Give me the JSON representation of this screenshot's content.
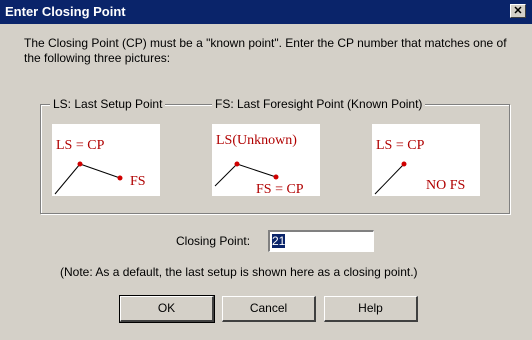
{
  "dialog": {
    "title": "Enter Closing Point",
    "close_glyph": "✕",
    "instructions": "The Closing Point (CP) must be a \"known point\". Enter the CP number that matches one of the following three pictures:"
  },
  "group": {
    "ls_legend": "LS: Last Setup Point",
    "fs_legend": "FS: Last Foresight Point (Known Point)",
    "pictures": [
      {
        "labels": [
          "LS = CP",
          "FS"
        ]
      },
      {
        "labels": [
          "LS(Unknown)",
          "FS = CP"
        ]
      },
      {
        "labels": [
          "LS = CP",
          "NO FS"
        ]
      }
    ],
    "line_color": "#000000",
    "point_color": "#d00000",
    "label_color": "#b00000"
  },
  "closing_point": {
    "label": "Closing Point:",
    "value": "21"
  },
  "note": "(Note: As a default, the last setup is shown here as a closing point.)",
  "buttons": {
    "ok": "OK",
    "cancel": "Cancel",
    "help": "Help"
  },
  "colors": {
    "titlebar": "#0a246a",
    "face": "#d4d0c8"
  }
}
